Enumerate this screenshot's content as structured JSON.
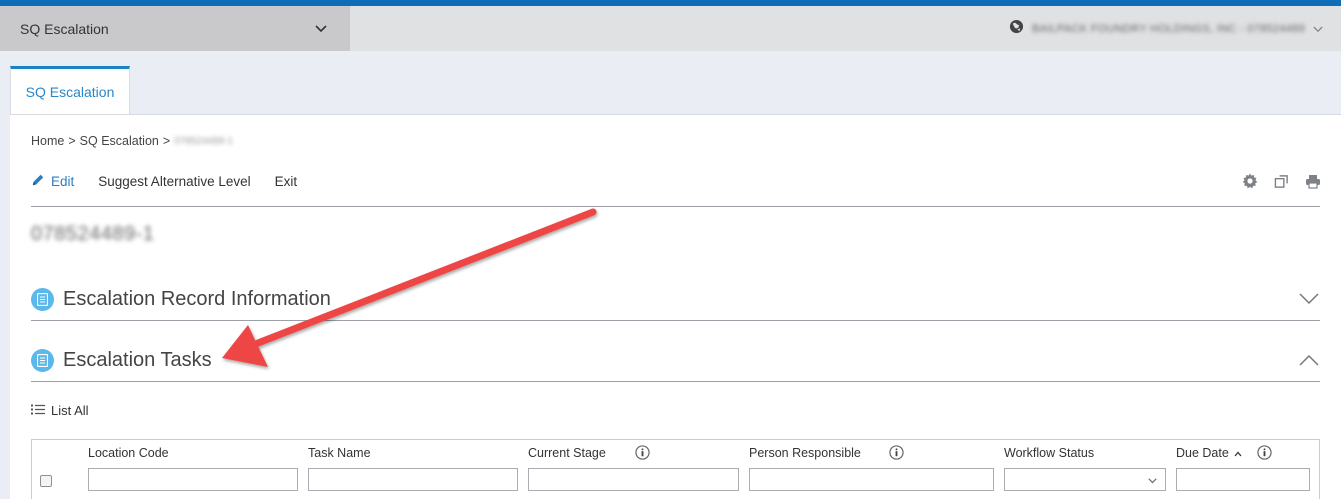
{
  "app_bar": {
    "module": "SQ Escalation",
    "organization": "BAILPACK FOUNDRY HOLDINGS, INC - 078524489"
  },
  "tab": {
    "label": "SQ Escalation"
  },
  "breadcrumb": {
    "home": "Home",
    "separator": ">",
    "module": "SQ Escalation",
    "record": "078524489-1"
  },
  "toolbar": {
    "edit": "Edit",
    "suggest": "Suggest Alternative Level",
    "exit": "Exit"
  },
  "record_id": "078524489-1",
  "sections": {
    "record_info": {
      "title": "Escalation Record Information",
      "state": "collapsed"
    },
    "tasks": {
      "title": "Escalation Tasks",
      "state": "expanded"
    }
  },
  "list_all": "List All",
  "grid": {
    "columns": {
      "location_code": "Location Code",
      "task_name": "Task Name",
      "current_stage": "Current Stage",
      "person_responsible": "Person Responsible",
      "workflow_status": "Workflow Status",
      "due_date": "Due Date"
    },
    "sort_indicator": "^"
  },
  "colors": {
    "accent": "#0f6db7",
    "tab_blue": "#2a86c7",
    "section_icon": "#5ab9ea",
    "annotation_arrow": "#ee4444"
  }
}
